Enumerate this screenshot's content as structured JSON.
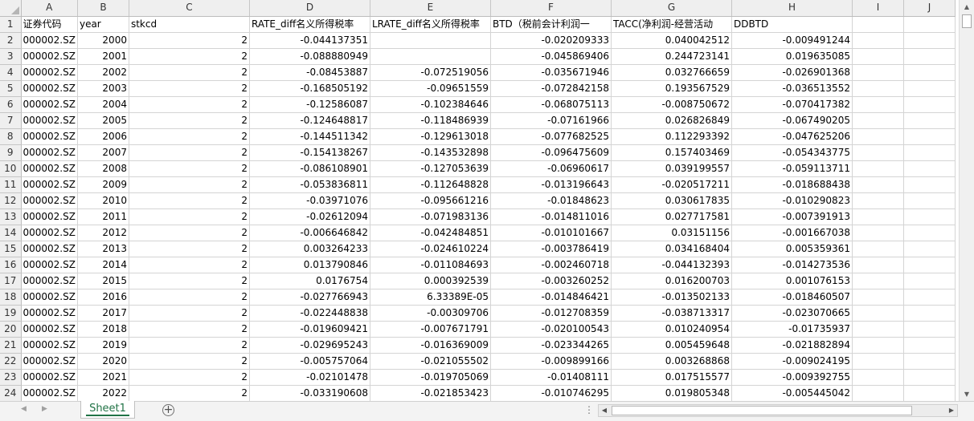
{
  "columns": [
    "A",
    "B",
    "C",
    "D",
    "E",
    "F",
    "G",
    "H",
    "I",
    "J"
  ],
  "header_row": {
    "num": "1",
    "A": "证券代码",
    "B": "year",
    "C": "stkcd",
    "D": "RATE_diff名义所得税率",
    "E": "LRATE_diff名义所得税率",
    "F": "BTD（税前会计利润一",
    "G": "TACC(净利润-经营活动",
    "H": "DDBTD"
  },
  "rows": [
    {
      "num": "2",
      "A": "000002.SZ",
      "B": "2000",
      "C": "2",
      "D": "-0.044137351",
      "E": "",
      "F": "-0.020209333",
      "G": "0.040042512",
      "H": "-0.009491244"
    },
    {
      "num": "3",
      "A": "000002.SZ",
      "B": "2001",
      "C": "2",
      "D": "-0.088880949",
      "E": "",
      "F": "-0.045869406",
      "G": "0.244723141",
      "H": "0.019635085"
    },
    {
      "num": "4",
      "A": "000002.SZ",
      "B": "2002",
      "C": "2",
      "D": "-0.08453887",
      "E": "-0.072519056",
      "F": "-0.035671946",
      "G": "0.032766659",
      "H": "-0.026901368"
    },
    {
      "num": "5",
      "A": "000002.SZ",
      "B": "2003",
      "C": "2",
      "D": "-0.168505192",
      "E": "-0.09651559",
      "F": "-0.072842158",
      "G": "0.193567529",
      "H": "-0.036513552"
    },
    {
      "num": "6",
      "A": "000002.SZ",
      "B": "2004",
      "C": "2",
      "D": "-0.12586087",
      "E": "-0.102384646",
      "F": "-0.068075113",
      "G": "-0.008750672",
      "H": "-0.070417382"
    },
    {
      "num": "7",
      "A": "000002.SZ",
      "B": "2005",
      "C": "2",
      "D": "-0.124648817",
      "E": "-0.118486939",
      "F": "-0.07161966",
      "G": "0.026826849",
      "H": "-0.067490205"
    },
    {
      "num": "8",
      "A": "000002.SZ",
      "B": "2006",
      "C": "2",
      "D": "-0.144511342",
      "E": "-0.129613018",
      "F": "-0.077682525",
      "G": "0.112293392",
      "H": "-0.047625206"
    },
    {
      "num": "9",
      "A": "000002.SZ",
      "B": "2007",
      "C": "2",
      "D": "-0.154138267",
      "E": "-0.143532898",
      "F": "-0.096475609",
      "G": "0.157403469",
      "H": "-0.054343775"
    },
    {
      "num": "10",
      "A": "000002.SZ",
      "B": "2008",
      "C": "2",
      "D": "-0.086108901",
      "E": "-0.127053639",
      "F": "-0.06960617",
      "G": "0.039199557",
      "H": "-0.059113711"
    },
    {
      "num": "11",
      "A": "000002.SZ",
      "B": "2009",
      "C": "2",
      "D": "-0.053836811",
      "E": "-0.112648828",
      "F": "-0.013196643",
      "G": "-0.020517211",
      "H": "-0.018688438"
    },
    {
      "num": "12",
      "A": "000002.SZ",
      "B": "2010",
      "C": "2",
      "D": "-0.03971076",
      "E": "-0.095661216",
      "F": "-0.01848623",
      "G": "0.030617835",
      "H": "-0.010290823"
    },
    {
      "num": "13",
      "A": "000002.SZ",
      "B": "2011",
      "C": "2",
      "D": "-0.02612094",
      "E": "-0.071983136",
      "F": "-0.014811016",
      "G": "0.027717581",
      "H": "-0.007391913"
    },
    {
      "num": "14",
      "A": "000002.SZ",
      "B": "2012",
      "C": "2",
      "D": "-0.006646842",
      "E": "-0.042484851",
      "F": "-0.010101667",
      "G": "0.03151156",
      "H": "-0.001667038"
    },
    {
      "num": "15",
      "A": "000002.SZ",
      "B": "2013",
      "C": "2",
      "D": "0.003264233",
      "E": "-0.024610224",
      "F": "-0.003786419",
      "G": "0.034168404",
      "H": "0.005359361"
    },
    {
      "num": "16",
      "A": "000002.SZ",
      "B": "2014",
      "C": "2",
      "D": "0.013790846",
      "E": "-0.011084693",
      "F": "-0.002460718",
      "G": "-0.044132393",
      "H": "-0.014273536"
    },
    {
      "num": "17",
      "A": "000002.SZ",
      "B": "2015",
      "C": "2",
      "D": "0.0176754",
      "E": "0.000392539",
      "F": "-0.003260252",
      "G": "0.016200703",
      "H": "0.001076153"
    },
    {
      "num": "18",
      "A": "000002.SZ",
      "B": "2016",
      "C": "2",
      "D": "-0.027766943",
      "E": "6.33389E-05",
      "F": "-0.014846421",
      "G": "-0.013502133",
      "H": "-0.018460507"
    },
    {
      "num": "19",
      "A": "000002.SZ",
      "B": "2017",
      "C": "2",
      "D": "-0.022448838",
      "E": "-0.00309706",
      "F": "-0.012708359",
      "G": "-0.038713317",
      "H": "-0.023070665"
    },
    {
      "num": "20",
      "A": "000002.SZ",
      "B": "2018",
      "C": "2",
      "D": "-0.019609421",
      "E": "-0.007671791",
      "F": "-0.020100543",
      "G": "0.010240954",
      "H": "-0.01735937"
    },
    {
      "num": "21",
      "A": "000002.SZ",
      "B": "2019",
      "C": "2",
      "D": "-0.029695243",
      "E": "-0.016369009",
      "F": "-0.023344265",
      "G": "0.005459648",
      "H": "-0.021882894"
    },
    {
      "num": "22",
      "A": "000002.SZ",
      "B": "2020",
      "C": "2",
      "D": "-0.005757064",
      "E": "-0.021055502",
      "F": "-0.009899166",
      "G": "0.003268868",
      "H": "-0.009024195"
    },
    {
      "num": "23",
      "A": "000002.SZ",
      "B": "2021",
      "C": "2",
      "D": "-0.02101478",
      "E": "-0.019705069",
      "F": "-0.01408111",
      "G": "0.017515577",
      "H": "-0.009392755"
    },
    {
      "num": "24",
      "A": "000002.SZ",
      "B": "2022",
      "C": "2",
      "D": "-0.033190608",
      "E": "-0.021853423",
      "F": "-0.010746295",
      "G": "0.019805348",
      "H": "-0.005445042"
    }
  ],
  "sheet_tab": "Sheet1",
  "icons": {
    "add_sheet": "plus-circle-icon",
    "scroll_up": "triangle-up-icon",
    "scroll_down": "triangle-down-icon",
    "scroll_left": "triangle-left-icon",
    "scroll_right": "triangle-right-icon"
  },
  "colors": {
    "accent": "#217346",
    "header_bg": "#efefef",
    "grid": "#d4d4d4"
  }
}
